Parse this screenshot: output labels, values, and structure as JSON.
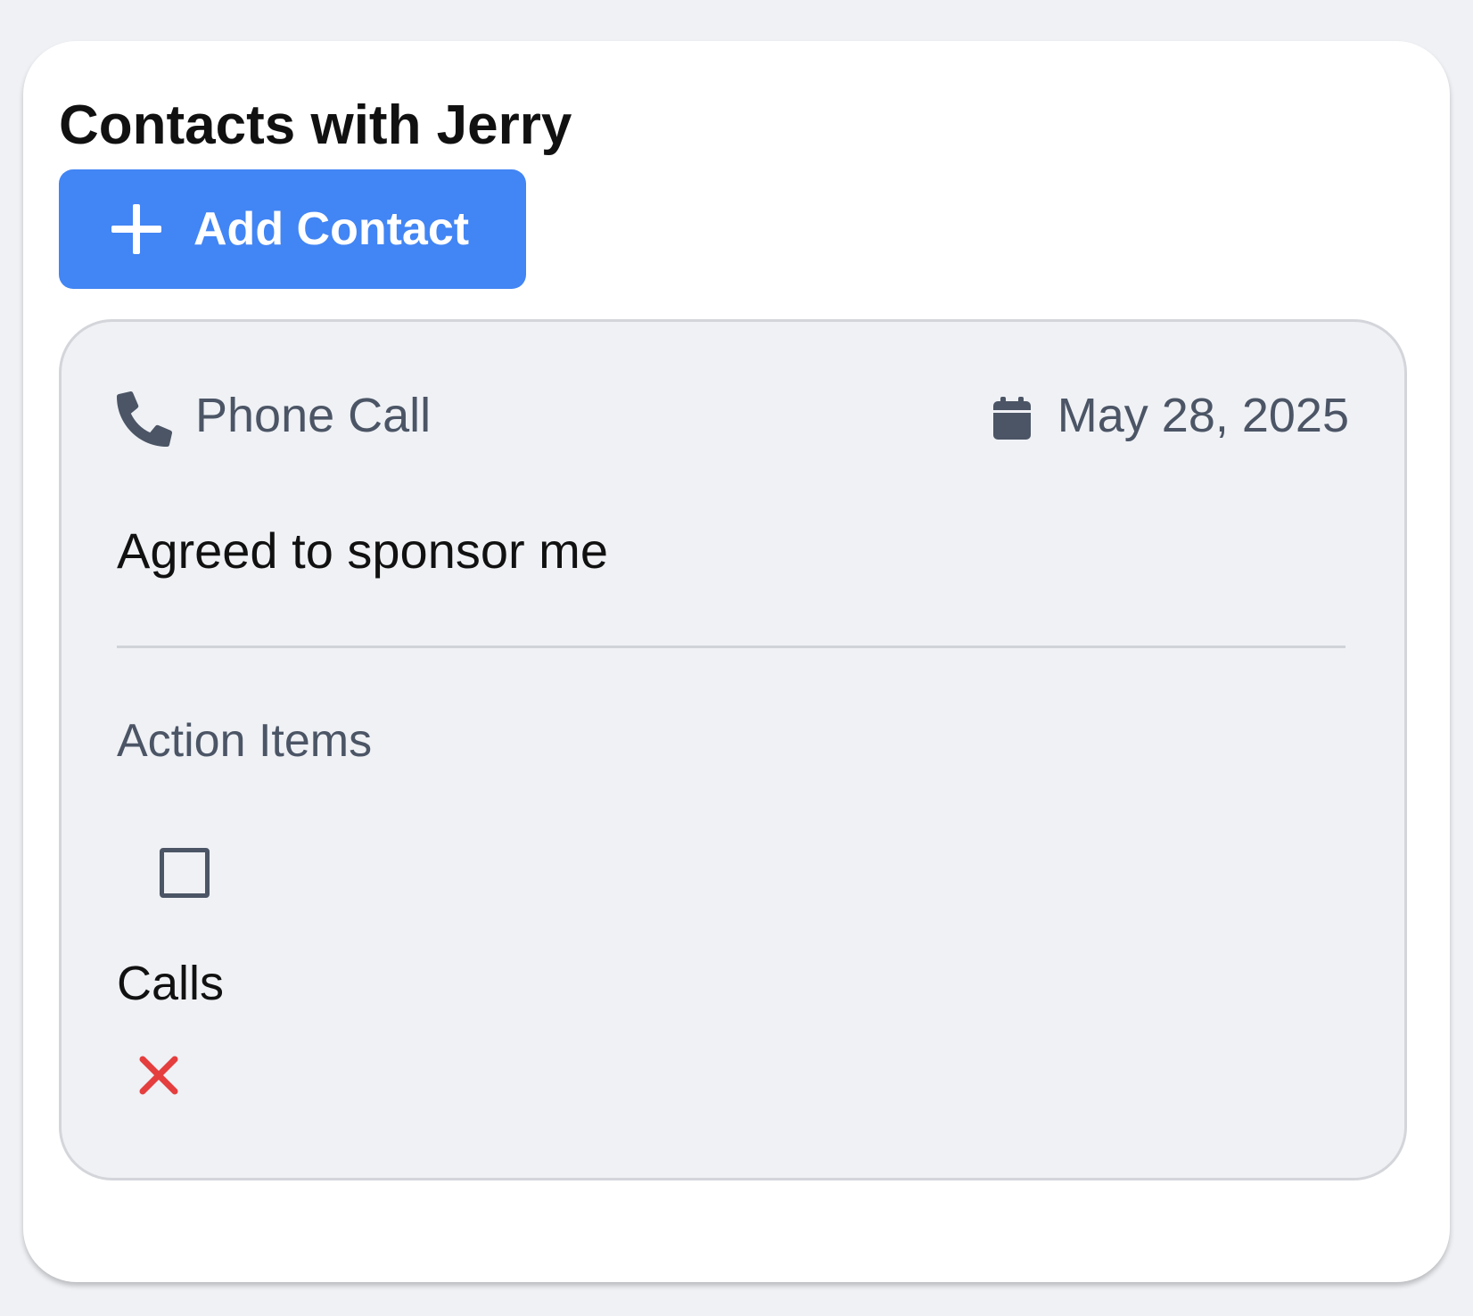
{
  "section": {
    "title": "Contacts with Jerry"
  },
  "add_button": {
    "label": "Add Contact",
    "icon": "plus-icon",
    "color": "#4285f4"
  },
  "contact": {
    "type_icon": "phone-icon",
    "type_label": "Phone Call",
    "date_icon": "calendar-icon",
    "date": "May 28, 2025",
    "note": "Agreed to sponsor me",
    "action_items": {
      "heading": "Action Items",
      "items": [
        {
          "checked": false,
          "text": "Calls",
          "delete_icon": "close-icon",
          "delete_color": "#e53e3e"
        }
      ]
    }
  }
}
